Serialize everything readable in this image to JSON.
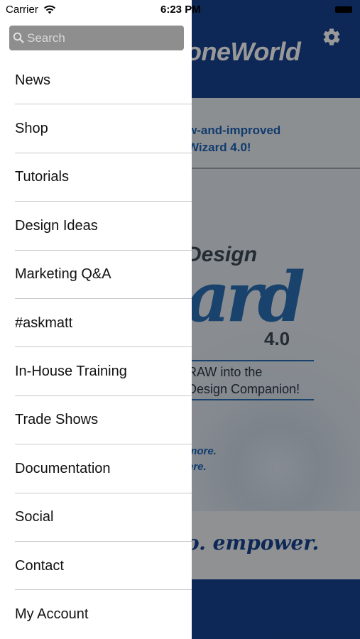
{
  "status_bar": {
    "carrier": "Carrier",
    "time": "6:23 PM"
  },
  "drawer": {
    "search": {
      "placeholder": "Search",
      "value": ""
    },
    "menu_items": [
      {
        "label": "News"
      },
      {
        "label": "Shop"
      },
      {
        "label": "Tutorials"
      },
      {
        "label": "Design Ideas"
      },
      {
        "label": "Marketing Q&A"
      },
      {
        "label": "#askmatt"
      },
      {
        "label": "In-House Training"
      },
      {
        "label": "Trade Shows"
      },
      {
        "label": "Documentation"
      },
      {
        "label": "Social"
      },
      {
        "label": "Contact"
      },
      {
        "label": "My Account"
      }
    ]
  },
  "background": {
    "logo": "oneWorld",
    "headline": [
      "w-and-improved",
      "Wizard 4.0!"
    ],
    "banner_design": "Design",
    "banner_wizard": "ard",
    "banner_version": "4.0",
    "banner_tagline": [
      "RAW into the",
      "Design Companion!"
    ],
    "more_link": [
      "more.",
      "ere."
    ],
    "slogan": "o.  empower."
  },
  "colors": {
    "header_blue": "#17428f",
    "accent_blue": "#1c64b8",
    "search_bg": "#8e8e8e"
  },
  "icons": {
    "search": "search-icon",
    "settings": "gear-icon",
    "wifi": "wifi-icon",
    "battery": "battery-icon"
  }
}
